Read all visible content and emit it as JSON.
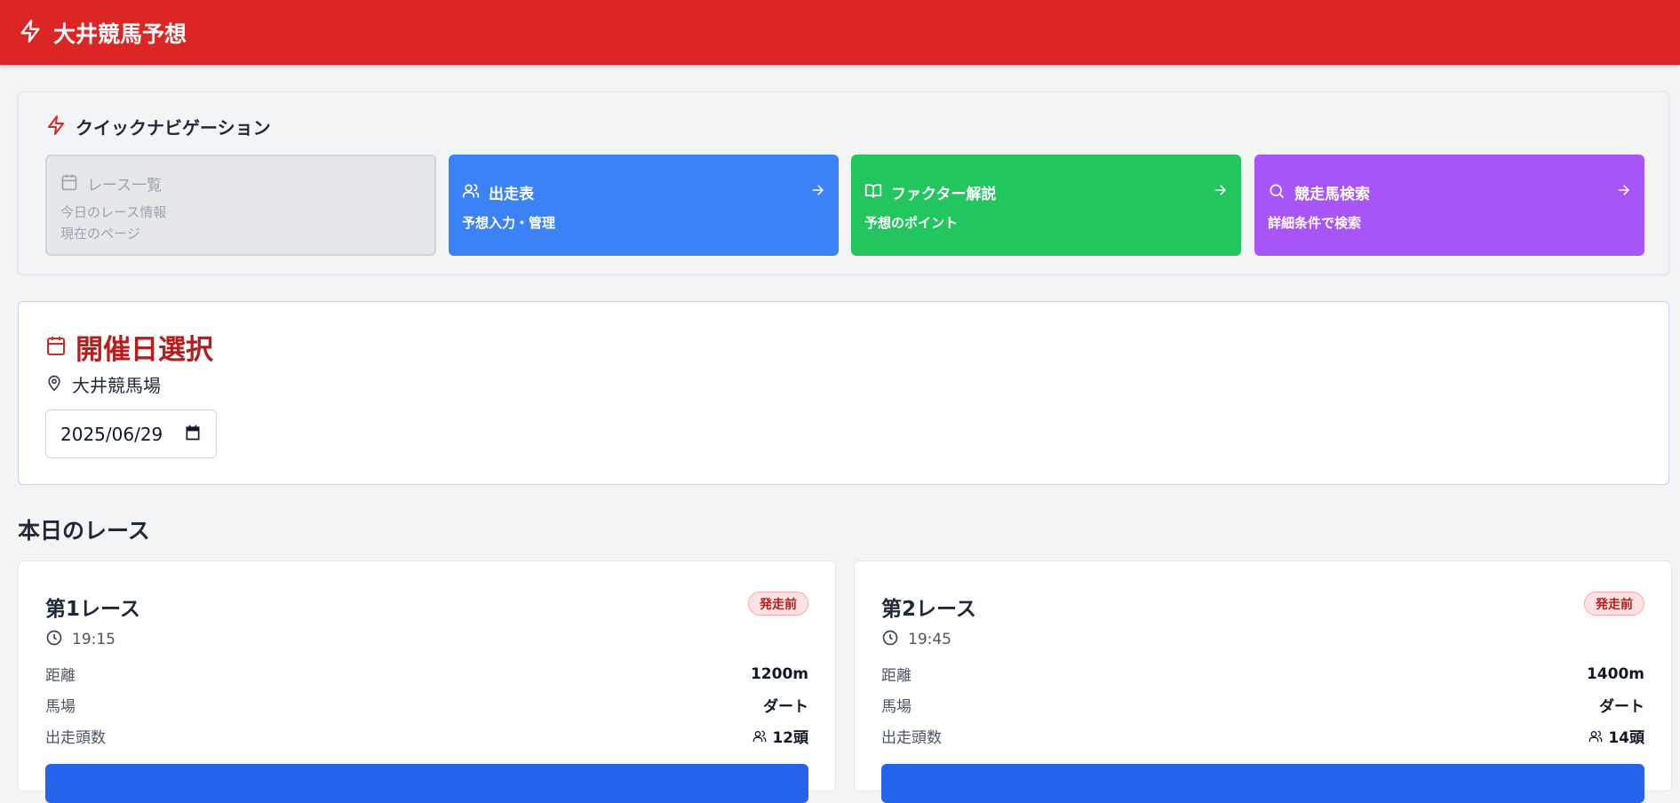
{
  "header": {
    "title": "大井競馬予想",
    "icon": "lightning-icon",
    "bg_color": "#dc2626"
  },
  "quick_nav": {
    "title": "クイックナビゲーション",
    "items": [
      {
        "title": "レース一覧",
        "sub1": "今日のレース情報",
        "sub2": "現在のページ",
        "icon": "calendar-icon",
        "state": "current"
      },
      {
        "title": "出走表",
        "sub1": "予想入力・管理",
        "icon": "users-icon",
        "color": "#3b82f6"
      },
      {
        "title": "ファクター解説",
        "sub1": "予想のポイント",
        "icon": "book-icon",
        "color": "#22c55e"
      },
      {
        "title": "競走馬検索",
        "sub1": "詳細条件で検索",
        "icon": "search-icon",
        "color": "#a855f7"
      }
    ]
  },
  "date_select": {
    "title": "開催日選択",
    "venue": "大井競馬場",
    "date_value": "2025/06/29"
  },
  "today": {
    "title": "本日のレース",
    "races": [
      {
        "name": "第1レース",
        "status": "発走前",
        "time": "19:15",
        "distance_label": "距離",
        "distance": "1200m",
        "track_label": "馬場",
        "track": "ダート",
        "runners_label": "出走頭数",
        "runners": "12頭"
      },
      {
        "name": "第2レース",
        "status": "発走前",
        "time": "19:45",
        "distance_label": "距離",
        "distance": "1400m",
        "track_label": "馬場",
        "track": "ダート",
        "runners_label": "出走頭数",
        "runners": "14頭"
      }
    ]
  }
}
